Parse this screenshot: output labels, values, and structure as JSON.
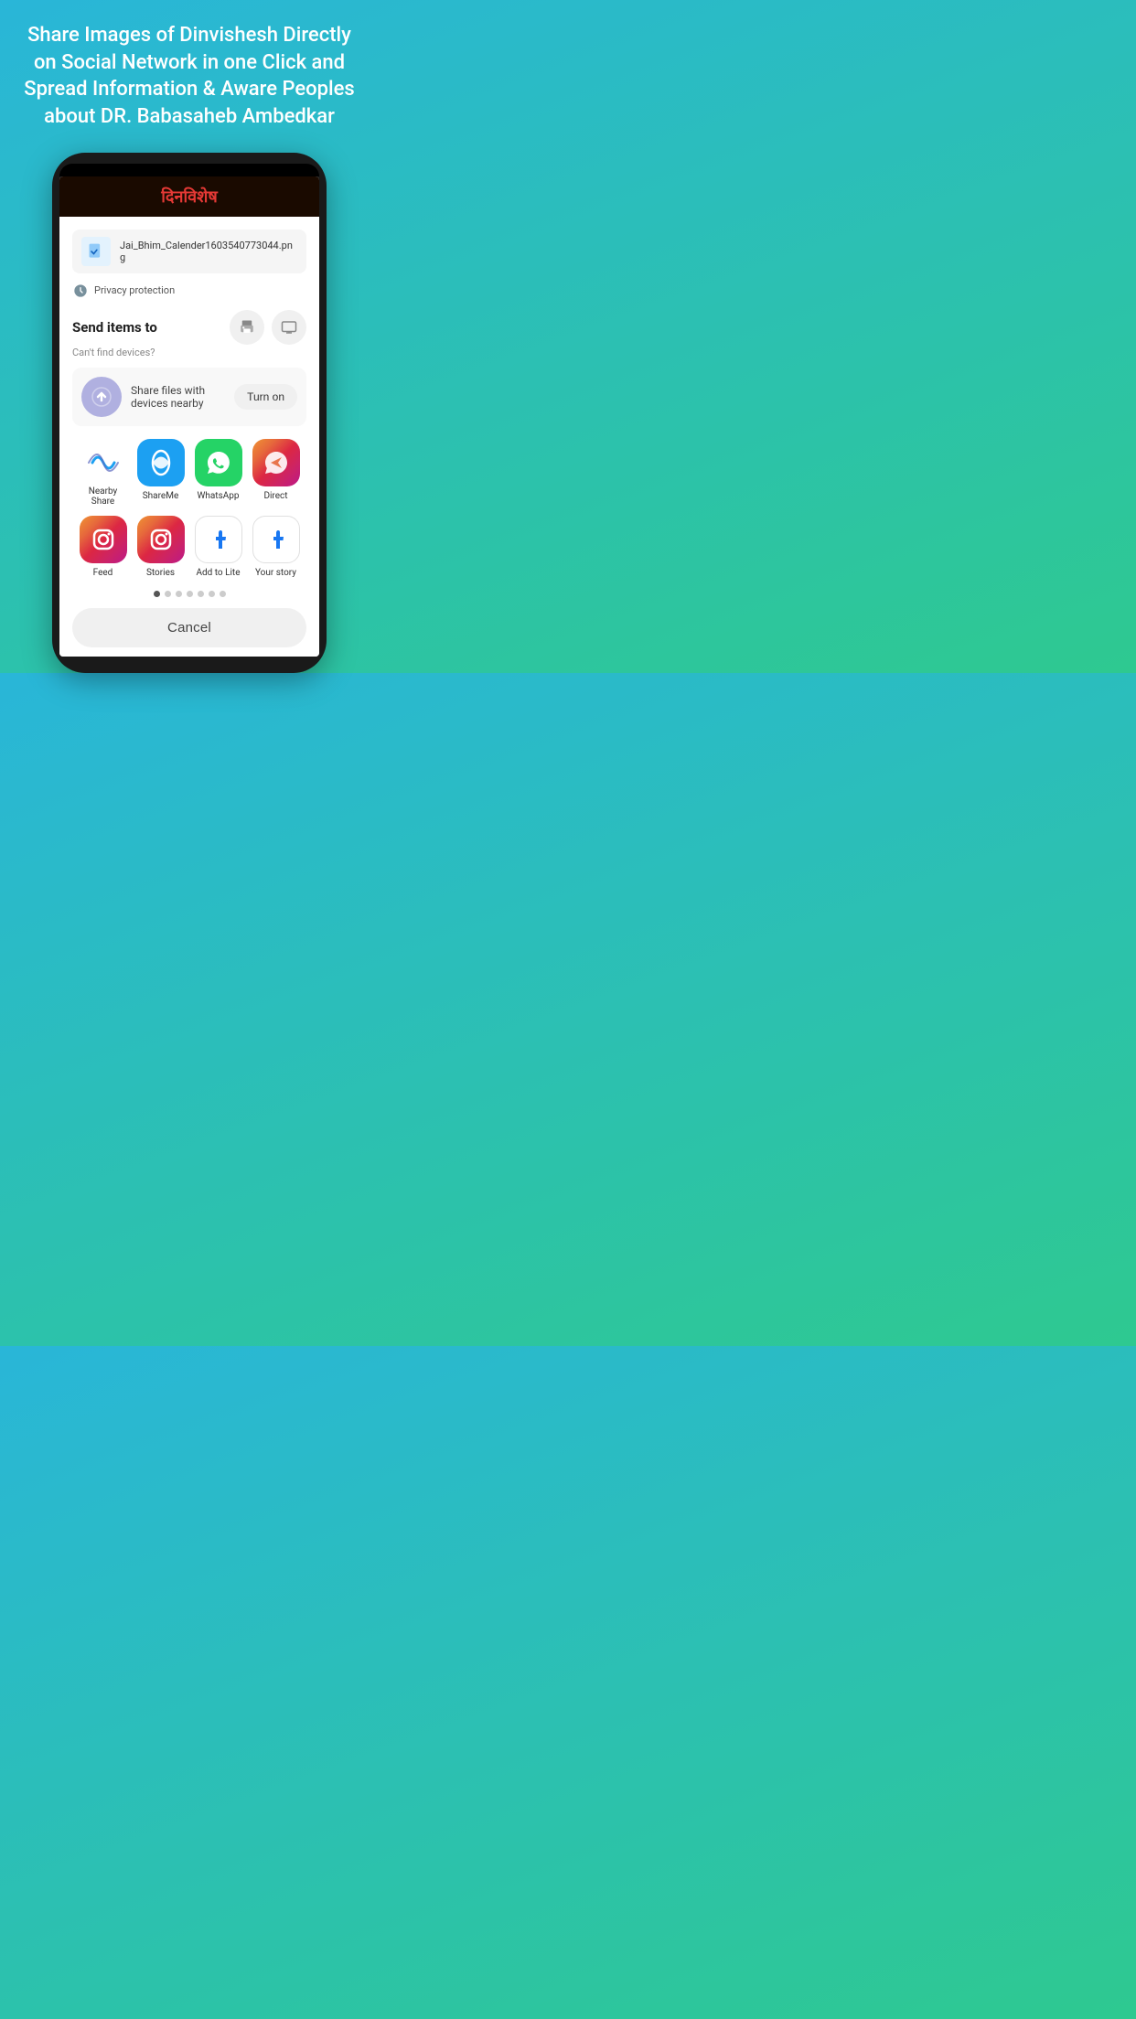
{
  "headline": "Share Images of Dinvishesh Directly on Social Network in one Click and Spread  Information & Aware Peoples about DR. Babasaheb Ambedkar",
  "app_title": "दिनविशेष",
  "file_name": "Jai_Bhim_Calender1603540773044.png",
  "privacy_text": "Privacy protection",
  "send_title": "Send items to",
  "cant_find": "Can't find devices?",
  "nearby_text": "Share files with devices nearby",
  "turn_on": "Turn on",
  "apps": [
    {
      "label": "Nearby Share",
      "type": "nearby"
    },
    {
      "label": "ShareMe",
      "type": "shareme"
    },
    {
      "label": "WhatsApp",
      "type": "whatsapp"
    },
    {
      "label": "Direct",
      "type": "direct"
    },
    {
      "label": "Feed",
      "type": "feed"
    },
    {
      "label": "Stories",
      "type": "stories"
    },
    {
      "label": "Add to Lite",
      "type": "addfb"
    },
    {
      "label": "Your story",
      "type": "yourstory"
    }
  ],
  "dots": [
    true,
    false,
    false,
    false,
    false,
    false,
    false
  ],
  "cancel_label": "Cancel"
}
